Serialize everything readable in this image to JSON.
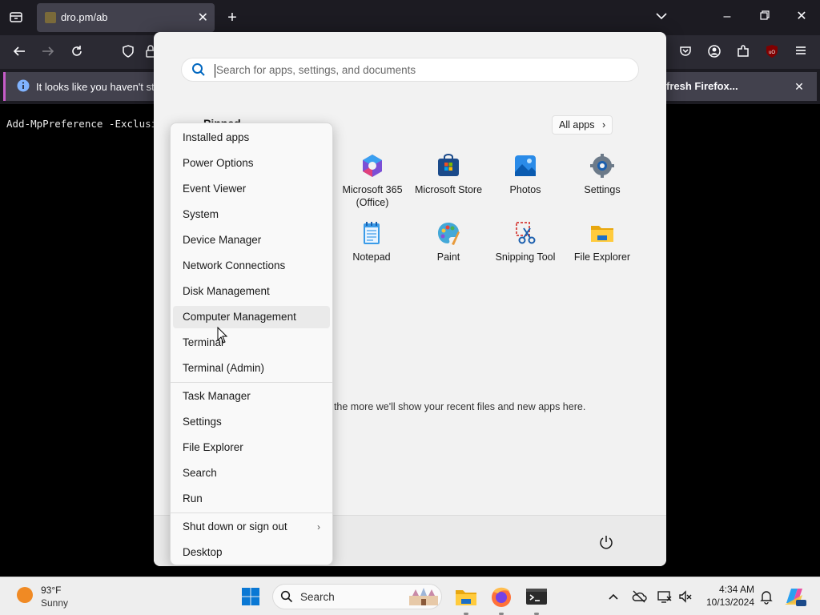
{
  "browser": {
    "tab_title": "dro.pm/ab",
    "infobar_message": "It looks like you haven't star",
    "infobar_action": "fresh Firefox..."
  },
  "terminal": {
    "command_text": "Add-MpPreference -Exclusio"
  },
  "start_menu": {
    "search_placeholder": "Search for apps, settings, and documents",
    "pinned_label": "Pinned",
    "all_apps_label": "All apps",
    "pinned_apps": [
      {
        "name": "Microsoft 365\n(Office)",
        "icon": "microsoft-365-icon"
      },
      {
        "name": "Microsoft Store",
        "icon": "microsoft-store-icon"
      },
      {
        "name": "Photos",
        "icon": "photos-icon"
      },
      {
        "name": "Settings",
        "icon": "settings-gear-icon"
      },
      {
        "name": "Notepad",
        "icon": "notepad-icon"
      },
      {
        "name": "Paint",
        "icon": "paint-icon"
      },
      {
        "name": "Snipping Tool",
        "icon": "snipping-tool-icon"
      },
      {
        "name": "File Explorer",
        "icon": "file-explorer-icon"
      }
    ],
    "recent_text": ", the more we'll show your recent files and new apps here."
  },
  "context_menu": {
    "items": [
      "Installed apps",
      "Power Options",
      "Event Viewer",
      "System",
      "Device Manager",
      "Network Connections",
      "Disk Management",
      "Computer Management",
      "Terminal",
      "Terminal (Admin)",
      "Task Manager",
      "Settings",
      "File Explorer",
      "Search",
      "Run",
      "Shut down or sign out",
      "Desktop"
    ],
    "hovered": "Computer Management"
  },
  "taskbar": {
    "weather_temp": "93°F",
    "weather_condition": "Sunny",
    "search_label": "Search",
    "time": "4:34 AM",
    "date": "10/13/2024"
  },
  "colors": {
    "accent": "#0067c0",
    "firefox_bar": "#2b2a33",
    "start_bg": "#f2f2f2"
  }
}
